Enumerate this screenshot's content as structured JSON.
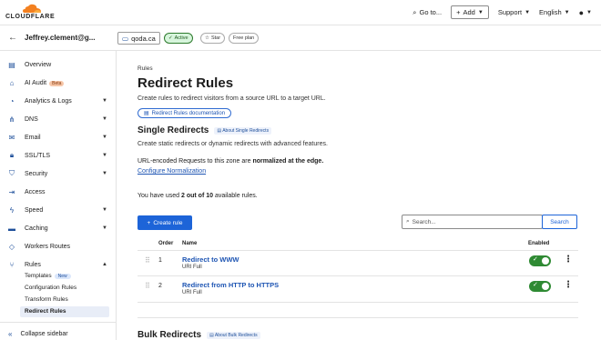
{
  "brand": {
    "name": "CLOUDFLARE",
    "accent": "#f38020",
    "link_color": "#1e55b3",
    "primary": "#1d64d8"
  },
  "topbar": {
    "goto_label": "Go to...",
    "add_label": "Add",
    "support_label": "Support",
    "language_label": "English"
  },
  "subbar": {
    "account": "Jeffrey.clement@g...",
    "zone": "qoda.ca",
    "status": "Active",
    "star_label": "Star",
    "plan": "Free plan"
  },
  "sidebar": {
    "items": [
      {
        "label": "Overview",
        "icon": "document-icon"
      },
      {
        "label": "AI Audit",
        "icon": "bot-icon",
        "badge": "Beta"
      },
      {
        "label": "Analytics & Logs",
        "icon": "chart-icon"
      },
      {
        "label": "DNS",
        "icon": "network-icon"
      },
      {
        "label": "Email",
        "icon": "mail-icon"
      },
      {
        "label": "SSL/TLS",
        "icon": "lock-icon"
      },
      {
        "label": "Security",
        "icon": "shield-icon"
      },
      {
        "label": "Access",
        "icon": "login-icon"
      },
      {
        "label": "Speed",
        "icon": "bolt-icon"
      },
      {
        "label": "Caching",
        "icon": "database-icon"
      },
      {
        "label": "Workers Routes",
        "icon": "diamond-icon"
      },
      {
        "label": "Rules",
        "icon": "fork-icon"
      }
    ],
    "rules_sub": [
      {
        "label": "Templates",
        "badge": "New"
      },
      {
        "label": "Configuration Rules"
      },
      {
        "label": "Transform Rules"
      },
      {
        "label": "Redirect Rules"
      }
    ],
    "collapse_label": "Collapse sidebar"
  },
  "main": {
    "breadcrumb": "Rules",
    "title": "Redirect Rules",
    "description": "Create rules to redirect visitors from a source URL to a target URL.",
    "doc_button": "Redirect Rules documentation",
    "single": {
      "title": "Single Redirects",
      "about": "About Single Redirects",
      "text": "Create static redirects or dynamic redirects with advanced features.",
      "normalized_prefix": "URL-encoded Requests to this zone are ",
      "normalized_bold": "normalized at the edge.",
      "configure_link": "Configure Normalization"
    },
    "usage_prefix": "You have used ",
    "usage_bold": "2 out of 10",
    "usage_suffix": " available rules.",
    "create_button": "Create rule",
    "search_placeholder": "Search...",
    "search_button": "Search",
    "columns": {
      "order": "Order",
      "name": "Name",
      "enabled": "Enabled"
    },
    "rules": [
      {
        "order": "1",
        "name": "Redirect to WWW",
        "sub": "URI Full",
        "enabled": true
      },
      {
        "order": "2",
        "name": "Redirect from HTTP to HTTPS",
        "sub": "URI Full",
        "enabled": true
      }
    ],
    "bulk": {
      "title": "Bulk Redirects",
      "about": "About Bulk Redirects"
    }
  }
}
